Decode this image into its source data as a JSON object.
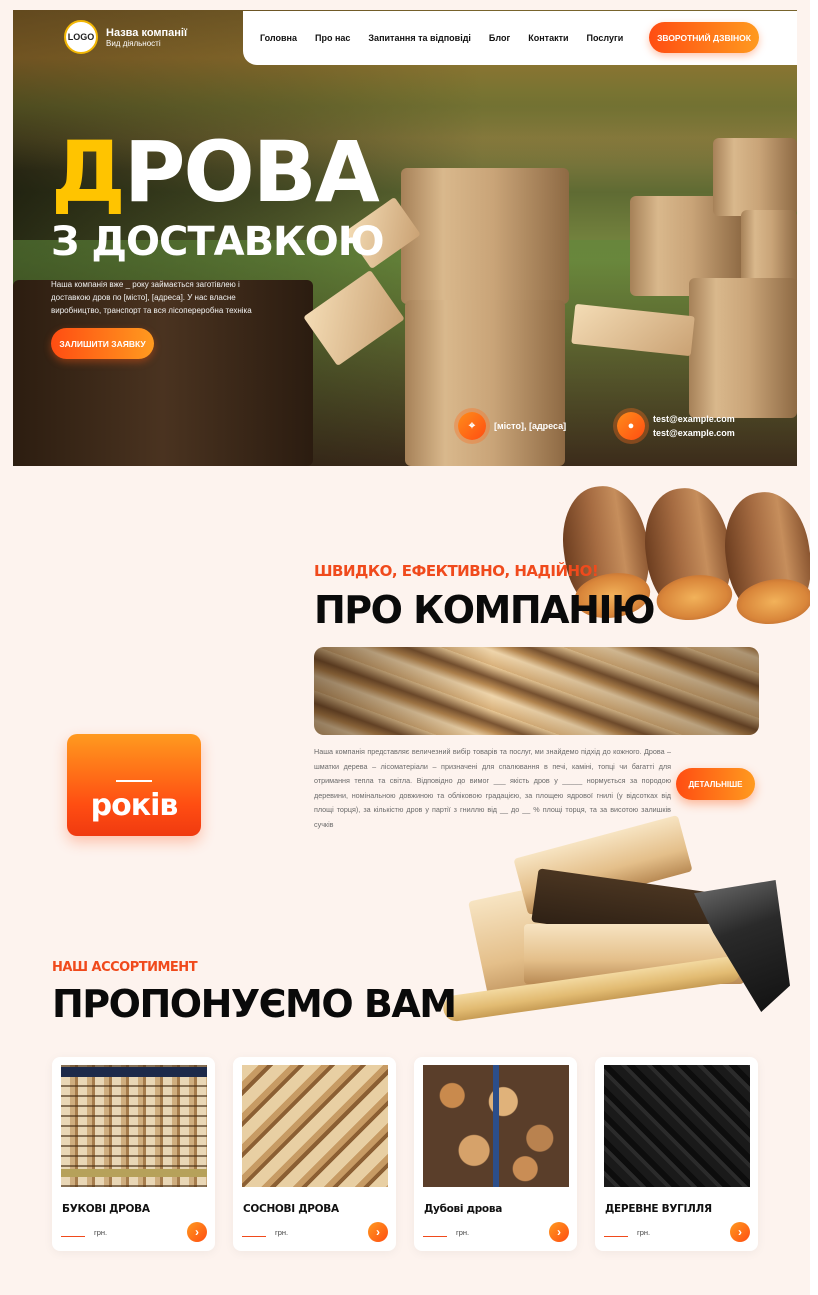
{
  "header": {
    "logo_text": "LOGO",
    "company_name": "Назва компанії",
    "company_activity": "Вид діяльності",
    "nav": [
      "Головна",
      "Про нас",
      "Запитання та відповіді",
      "Блог",
      "Контакти",
      "Послуги"
    ],
    "callback_label": "ЗВОРОТНИЙ ДЗВІНОК"
  },
  "hero": {
    "title_accent": "Д",
    "title_rest": "РОВА",
    "subtitle": "З ДОСТАВКОЮ",
    "description": "Наша компанія вже _ року займається заготівлею і доставкою дров по [місто], [адреса]. У нас власне виробництво, транспорт та вся лісопереробна техніка",
    "cta_label": "ЗАЛИШИТИ ЗАЯВКУ",
    "address": "[місто], [адреса]",
    "emails": [
      "test@example.com",
      "test@example.com"
    ]
  },
  "about": {
    "subtitle": "ШВИДКО, ЕФЕКТИВНО, НАДІЙНО!",
    "title": "ПРО КОМПАНІЮ",
    "text": "Наша компанія представляє величезний вибір товарів та послуг, ми знайдемо підхід до кожного. Дрова – шматки дерева – лісоматеріали – призначені для спалювання в печі, каміні, топці чи багатті для отримання тепла та світла. Відповідно до вимог ___ якість дров у _____ нормується за породою деревини, номінальною довжиною та обліковою градацією, за площею ядрової гнилі (у відсотках від площі торця), за кількістю дров у партії з гниллю від __ до __ % площі торця, та за висотою залишків сучків",
    "more_label": "ДЕТАЛЬНІШЕ",
    "years_label": "років"
  },
  "assortment": {
    "subtitle": "НАШ АССОРТИМЕНТ",
    "title": "ПРОПОНУЄМО ВАМ",
    "products": [
      {
        "title": "БУКОВІ ДРОВА",
        "unit": "грн."
      },
      {
        "title": "СОСНОВІ ДРОВА",
        "unit": "грн."
      },
      {
        "title": "Дубові дрова",
        "unit": "грн."
      },
      {
        "title": "ДЕРЕВНЕ ВУГІЛЛЯ",
        "unit": "грн."
      }
    ]
  },
  "icons": {
    "address": "location-pin-icon",
    "email": "mail-icon",
    "arrow": "chevron-right-icon"
  },
  "colors": {
    "accent_orange": "#ff4d12",
    "accent_yellow": "#ffc400",
    "background": "#fdf3ee"
  }
}
